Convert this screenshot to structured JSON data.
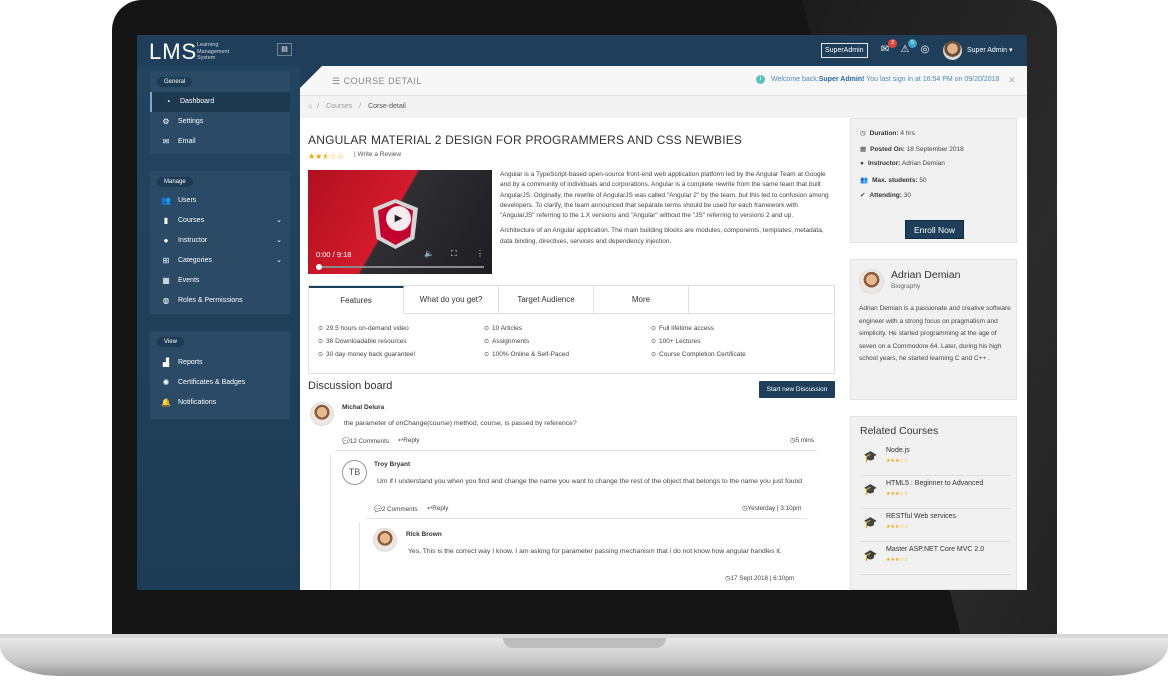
{
  "app": {
    "logo": "LMS",
    "logo_sub": "Learning Management System",
    "superadmin_badge": "SuperAdmin",
    "notif_count_1": "3",
    "notif_count_2": "5",
    "user_name": "Super Admin ▾"
  },
  "sidebar": {
    "general_head": "General",
    "general_items": [
      {
        "label": "Dashboard",
        "icon": "dashboard-icon"
      },
      {
        "label": "Settings",
        "icon": "gears-icon"
      },
      {
        "label": "Email",
        "icon": "envelope-icon"
      }
    ],
    "manage_head": "Manage",
    "manage_items": [
      {
        "label": "Users",
        "icon": "users-icon"
      },
      {
        "label": "Courses",
        "icon": "book-icon"
      },
      {
        "label": "Instructor",
        "icon": "user-icon"
      },
      {
        "label": "Categories",
        "icon": "sitemap-icon"
      },
      {
        "label": "Events",
        "icon": "calendar-icon"
      },
      {
        "label": "Roles & Permissions",
        "icon": "user-lock-icon"
      }
    ],
    "view_head": "View",
    "view_items": [
      {
        "label": "Reports",
        "icon": "bar-chart-icon"
      },
      {
        "label": "Certificates & Badges",
        "icon": "certificate-icon"
      },
      {
        "label": "Notifications",
        "icon": "bell-icon"
      }
    ]
  },
  "header": {
    "title": "COURSE DETAIL",
    "welcome_pre": "Welcome back,",
    "welcome_user": "Super Admin!",
    "welcome_post": " You last sign in at 16:54 PM on 09/20/2018",
    "breadcrumb": [
      "Courses",
      "/",
      "Corse-detail"
    ]
  },
  "course": {
    "title": "ANGULAR MATERIAL 2 DESIGN FOR PROGRAMMERS AND CSS NEWBIES",
    "rating": 2.5,
    "stars": "★★⯪☆☆",
    "write_review": "| Write a Review",
    "video_time": "0:00 / 9:18",
    "desc_1": "Angular is a TypeScript-based open-source front-end web application platform led by the Angular Team at Google and by a community of individuals and corporations. Angular is a complete rewrite from the same team that built AngularJS. Originally, the rewrite of AngularJS was called \"Angular 2\" by the team, but this led to confusion among developers. To clarify, the team announced that separate terms should be used for each framework with \"AngularJS\" referring to the 1.X versions and \"Angular\" without the \"JS\" referring to versions 2 and up.",
    "desc_2": "Architecture of an Angular application. The main building blocks are modules, components, templates, metadata, data binding, directives, services and dependency injection.",
    "tabs": [
      "Features",
      "What do you get?",
      "Target Audience",
      "More"
    ],
    "features": [
      [
        "29.5 hours on-demand video",
        "10 Articles",
        "Full lifetime access"
      ],
      [
        "38 Downloadable resources",
        "Assignments",
        "100+ Lectures"
      ],
      [
        "30 day money back guarantee!",
        "100% Online & Self-Paced",
        "Course Completion Certificate"
      ]
    ]
  },
  "discussion": {
    "title": "Discussion board",
    "new_button": "Start new Discussion",
    "c1": {
      "name": "Michal Delura",
      "text": "the parameter of onChange(course) method, course, is passed by reference?",
      "comments": "12 Comments",
      "reply": "Reply",
      "time": "5 mins"
    },
    "c2": {
      "initials": "TB",
      "name": "Troy Bryant",
      "text": "Um if I understand you when you find and change the name you want to change the rest of the object that belongs to the name you just found",
      "comments": "2 Comments",
      "reply": "Reply",
      "time": "Yesterday | 3:10pm"
    },
    "c3": {
      "name": "Rick Brown",
      "text": "Yes, This is the correct way I know. I am asking for parameter passing mechanism that i do not know how angular handles it.",
      "time": "17 Sept 2018 | 6:10pm"
    }
  },
  "info": {
    "duration_label": "Duration:",
    "duration": "4 hrs",
    "posted_label": "Posted On:",
    "posted": "18 September 2018",
    "instructor_label": "Instructor:",
    "instructor": "Adrian Demian",
    "max_label": "Max. students:",
    "max": "50",
    "attending_label": "Attending:",
    "attending": "30",
    "enroll": "Enroll Now"
  },
  "instructor": {
    "name": "Adrian Demian",
    "sub": "Biography",
    "bio": "Adrian Demian is a passionate and creative software engineer with a strong focus on pragmatism and simplicity. He started programming at the age of seven on a Commodore 64. Later, during his high school years, he started learning C and C++ ."
  },
  "related": {
    "title": "Related Courses",
    "items": [
      {
        "name": "Node.js",
        "stars": "★★★☆☆"
      },
      {
        "name": "HTML5 : Beginner to Advanced",
        "stars": "★★★☆☆"
      },
      {
        "name": "RESTful Web services",
        "stars": "★★⯪☆☆"
      },
      {
        "name": "Master ASP.NET Core MVC 2.0",
        "stars": "★★★☆☆"
      }
    ]
  },
  "colors": {
    "sidebar": "#1e3e59",
    "accent": "#1e3e59",
    "star": "#f0a500"
  }
}
